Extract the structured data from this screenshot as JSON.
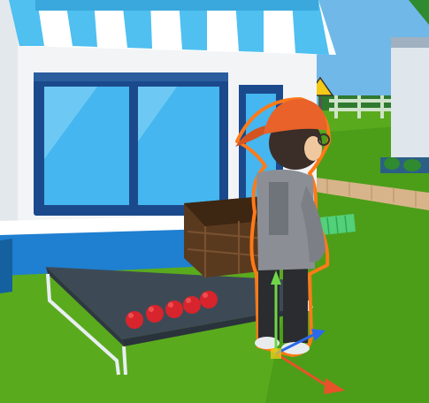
{
  "scene": {
    "type": "3d-game-editor-viewport",
    "selected_object": "character",
    "colors": {
      "sky": "#6fb8e8",
      "grass": "#5aaa1e",
      "grass_dark": "#3f8a14",
      "shop_wall": "#f2f4f6",
      "shop_base": "#1f7fd0",
      "awning_blue": "#4fc0f0",
      "awning_white": "#ffffff",
      "window_frame": "#1b4a8c",
      "window_glass": "#45b6ef",
      "platform": "#3d4a55",
      "platform_legs": "#e8eef2",
      "basket": "#5a3a1f",
      "apple": "#d8242c",
      "cap": "#e8622a",
      "hoodie": "#8b8f95",
      "pants": "#2a2c30",
      "selection_outline": "#ff7a18",
      "gizmo_x": "#e8522a",
      "gizmo_y": "#6fd64a",
      "gizmo_z": "#2a6ae8",
      "fence": "#cfe3c8",
      "sign": "#f5c918",
      "path": "#d8b48a"
    },
    "icons": [
      "move-gizmo-icon"
    ]
  }
}
